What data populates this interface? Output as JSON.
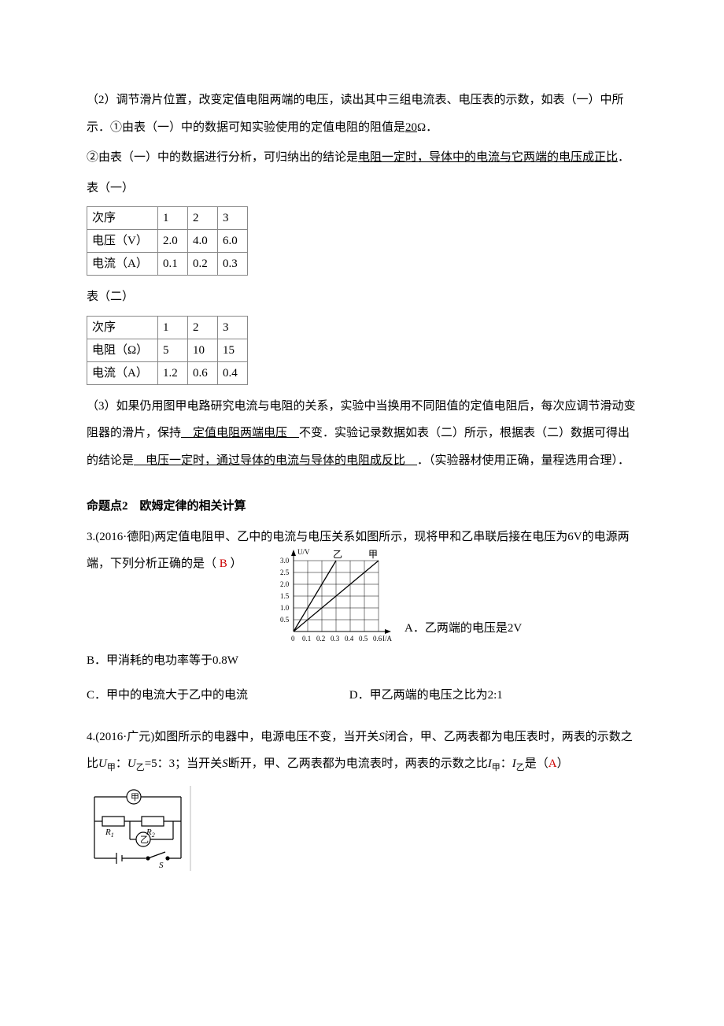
{
  "p1_a": "（2）调节滑片位置，改变定值电阻两端的电压，读出其中三组电流表、电压表的示数，如表（一）中所示．①由表（一）中的数据可知实验使用的定值电阻的阻值是",
  "p1_u": "20",
  "p1_b": "Ω．",
  "p2_a": "②由表（一）中的数据进行分析，可归纳出的结论是",
  "p2_u": "电阻一定时，导体中的电流与它两端的电压成正比",
  "p2_b": "．",
  "table1_caption": "表（一）",
  "table1": {
    "r0": {
      "c0": "次序",
      "c1": "1",
      "c2": "2",
      "c3": "3"
    },
    "r1": {
      "c0": "电压（V）",
      "c1": "2.0",
      "c2": "4.0",
      "c3": "6.0"
    },
    "r2": {
      "c0": "电流（A）",
      "c1": "0.1",
      "c2": "0.2",
      "c3": "0.3"
    }
  },
  "table2_caption": "表（二）",
  "table2": {
    "r0": {
      "c0": "次序",
      "c1": "1",
      "c2": "2",
      "c3": "3"
    },
    "r1": {
      "c0": "电阻（Ω）",
      "c1": "5",
      "c2": "10",
      "c3": "15"
    },
    "r2": {
      "c0": "电流（A）",
      "c1": "1.2",
      "c2": "0.6",
      "c3": "0.4"
    }
  },
  "p3_a": "（3）如果仍用图甲电路研究电流与电阻的关系，实验中当换用不同阻值的定值电阻后，每次应调节滑动变阻器的滑片，保持",
  "p3_u1": "　定值电阻两端电压　",
  "p3_b": "不变．实验记录数据如表（二）所示，根据表（二）数据可得出的结论是",
  "p3_u2": "　电压一定时，通过导体的电流与导体的电阻成反比　",
  "p3_c": "．（实验器材使用正确，量程选用合理）．",
  "sec2_title": "命题点2　欧姆定律的相关计算",
  "q3_a": "3.(2016·德阳)两定值电阻甲、乙中的电流与电压关系如图所示，现将甲和乙串联后接在电压为6V的电源两端，下列分析正确的是（",
  "q3_ans": " B ",
  "q3_b": "）",
  "q3_optA": "A．乙两端的电压是2V",
  "q3_optB": "B．甲消耗的电功率等于0.8W",
  "q3_optC": "C．甲中的电流大于乙中的电流",
  "q3_optD": "D．甲乙两端的电压之比为2:1",
  "q4_a": "4.(2016·广元)如图所示的电器中，电源电压不变，当开关",
  "q4_S": "S",
  "q4_b": "闭合，甲、乙两表都为电压表时，两表的示数之比",
  "q4_U": "U",
  "q4_jia": "甲",
  "q4_colon": "：",
  "q4_yi": "乙",
  "q4_c": "=5：3；当开关",
  "q4_d": "断开，甲、乙两表都为电流表时，两表的示数之比",
  "q4_I": "I",
  "q4_e": "是（",
  "q4_ans": "A",
  "q4_f": "）",
  "chart_data": {
    "type": "line",
    "xlabel": "I/A",
    "ylabel": "U/V",
    "x_ticks": [
      "0",
      "0.1",
      "0.2",
      "0.3",
      "0.4",
      "0.5",
      "0.6"
    ],
    "y_ticks": [
      "0.5",
      "1.0",
      "1.5",
      "2.0",
      "2.5",
      "3.0"
    ],
    "series": [
      {
        "name": "乙",
        "points": [
          [
            0,
            0
          ],
          [
            0.3,
            3.0
          ]
        ]
      },
      {
        "name": "甲",
        "points": [
          [
            0,
            0
          ],
          [
            0.6,
            3.0
          ]
        ]
      }
    ],
    "xlim": [
      0,
      0.6
    ],
    "ylim": [
      0,
      3.0
    ]
  },
  "circuit": {
    "meter1": "甲",
    "meter2": "乙",
    "r1": "R",
    "r1sub": "1",
    "r2": "R",
    "r2sub": "2",
    "sw": "S"
  }
}
